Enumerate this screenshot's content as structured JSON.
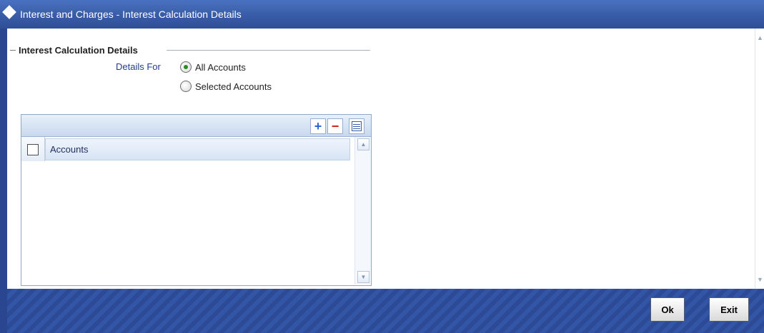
{
  "window": {
    "title": "Interest and Charges - Interest Calculation Details"
  },
  "section": {
    "title": "Interest Calculation Details"
  },
  "details_for": {
    "label": "Details For",
    "options": [
      {
        "label": "All Accounts",
        "selected": true
      },
      {
        "label": "Selected Accounts",
        "selected": false
      }
    ]
  },
  "grid": {
    "toolbar": {
      "add_icon": "plus-icon",
      "delete_icon": "minus-icon",
      "view_icon": "single-view-icon"
    },
    "columns": [
      "Accounts"
    ],
    "rows": []
  },
  "footer": {
    "ok_label": "Ok",
    "exit_label": "Exit"
  },
  "colors": {
    "title_bar": "#3a5da9",
    "footer": "#2c4a96",
    "radio_selected": "#2a8a24",
    "label_blue": "#243e8b",
    "delete_red": "#d32020"
  }
}
